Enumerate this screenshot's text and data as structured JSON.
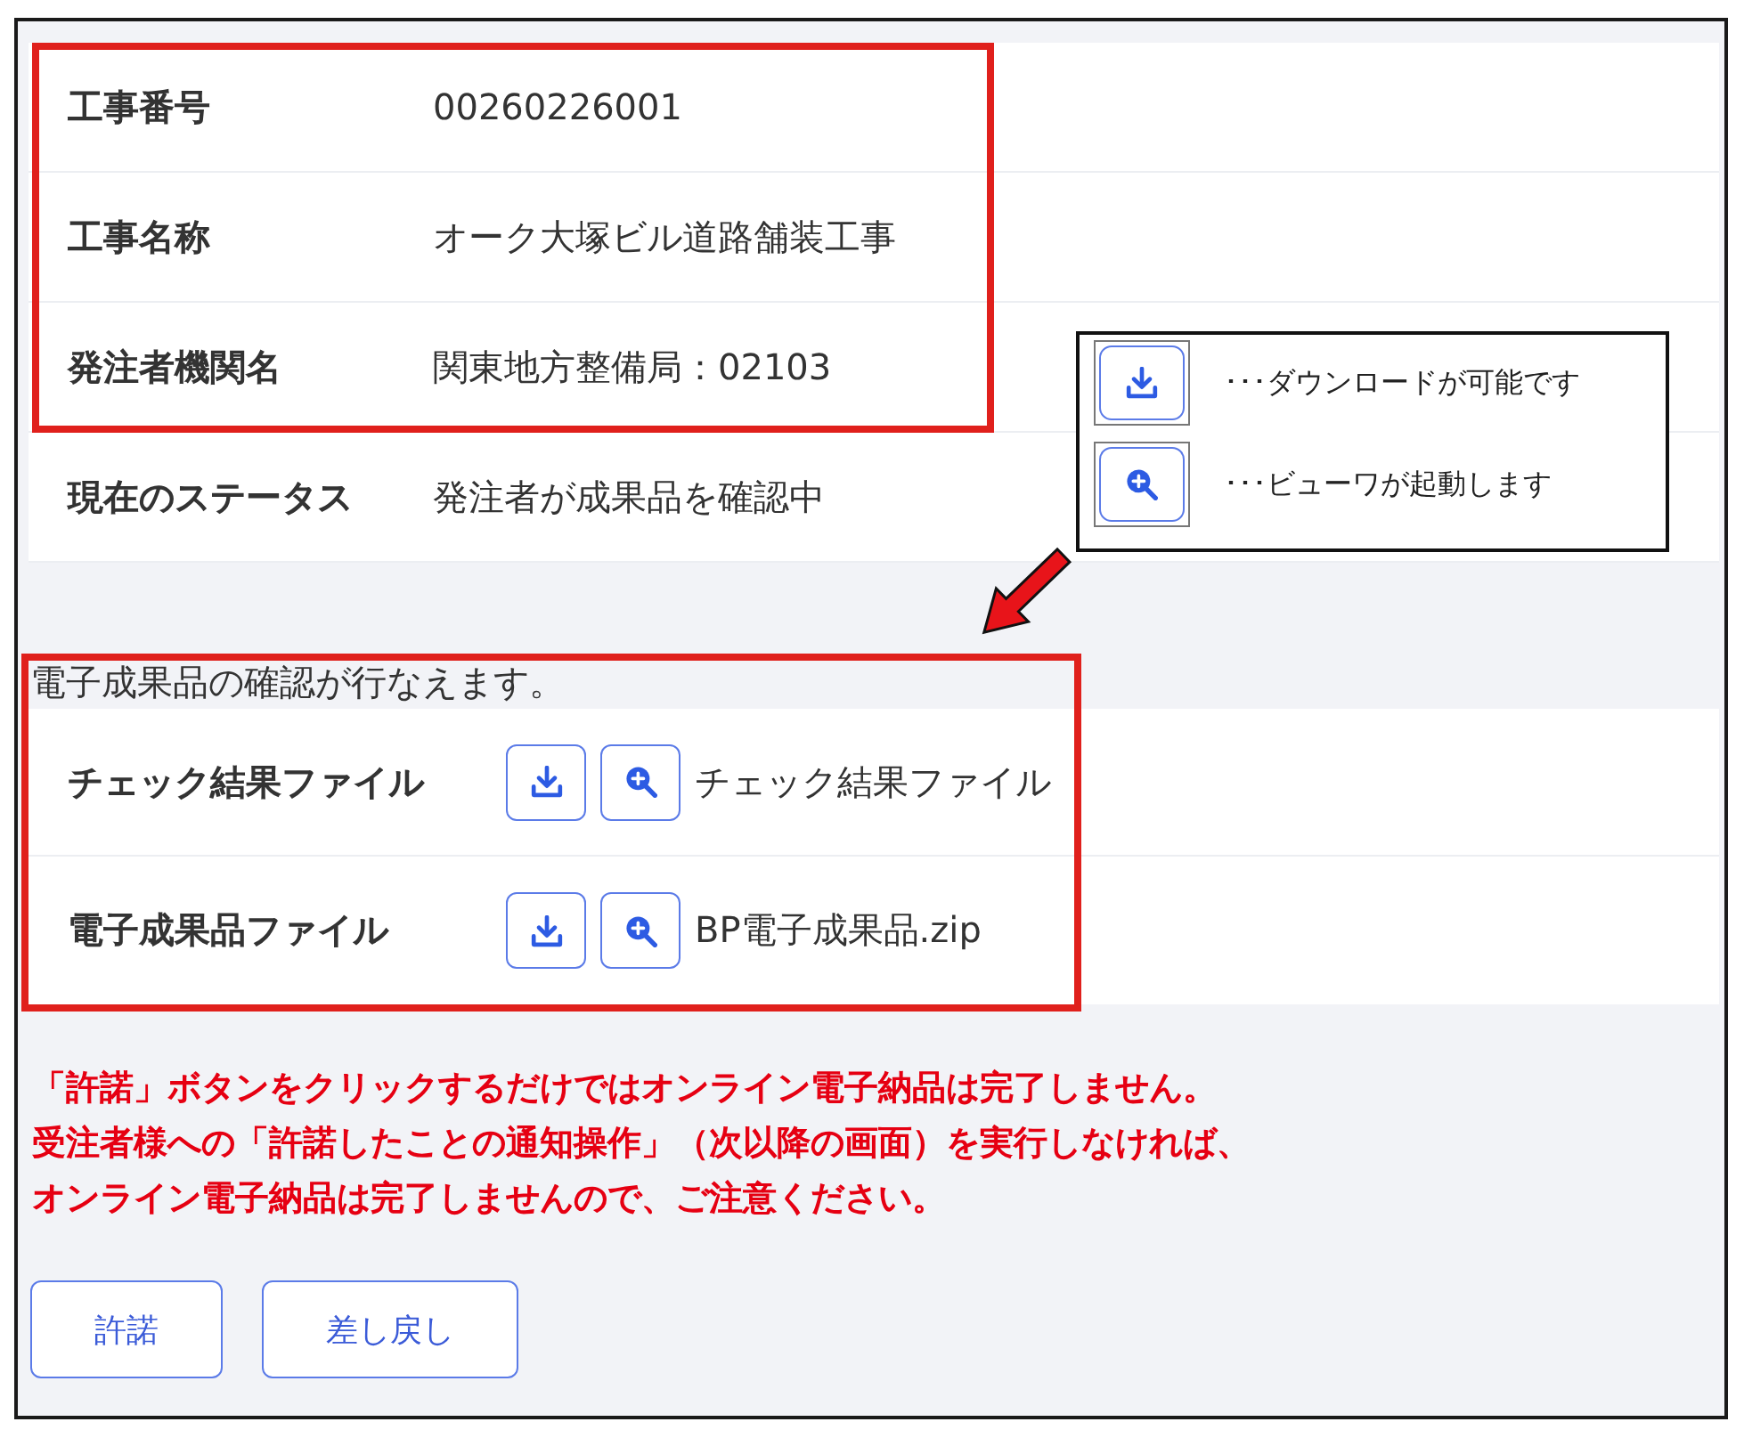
{
  "project_info": [
    {
      "highlighted": true,
      "rows": [
        {
          "label": "工事番号",
          "value": "00260226001"
        },
        {
          "label": "工事名称",
          "value": "オーク大塚ビル道路舗装工事"
        },
        {
          "label": "発注者機関名",
          "value": "関東地方整備局：02103"
        }
      ]
    },
    {
      "highlighted": false,
      "rows": [
        {
          "label": "現在のステータス",
          "value": "発注者が成果品を確認中"
        }
      ]
    }
  ],
  "legend": {
    "items": [
      {
        "kind": "download",
        "text": "･･･ダウンロードが可能です"
      },
      {
        "kind": "view",
        "text": "･･･ビューワが起動します"
      }
    ]
  },
  "deliverables": {
    "highlighted": true,
    "note": "電子成果品の確認が行なえます。",
    "files": [
      {
        "label": "チェック結果ファイル",
        "file_name": "チェック結果ファイル"
      },
      {
        "label": "電子成果品ファイル",
        "file_name": "BP電子成果品.zip"
      }
    ]
  },
  "warning": {
    "lines": [
      "「許諾」ボタンをクリックするだけではオンライン電子納品は完了しません。",
      "受注者様への「許諾したことの通知操作」（次以降の画面）を実行しなければ、",
      "オンライン電子納品は完了しませんので、ご注意ください。"
    ]
  },
  "buttons": [
    "許諾",
    "差し戻し"
  ]
}
